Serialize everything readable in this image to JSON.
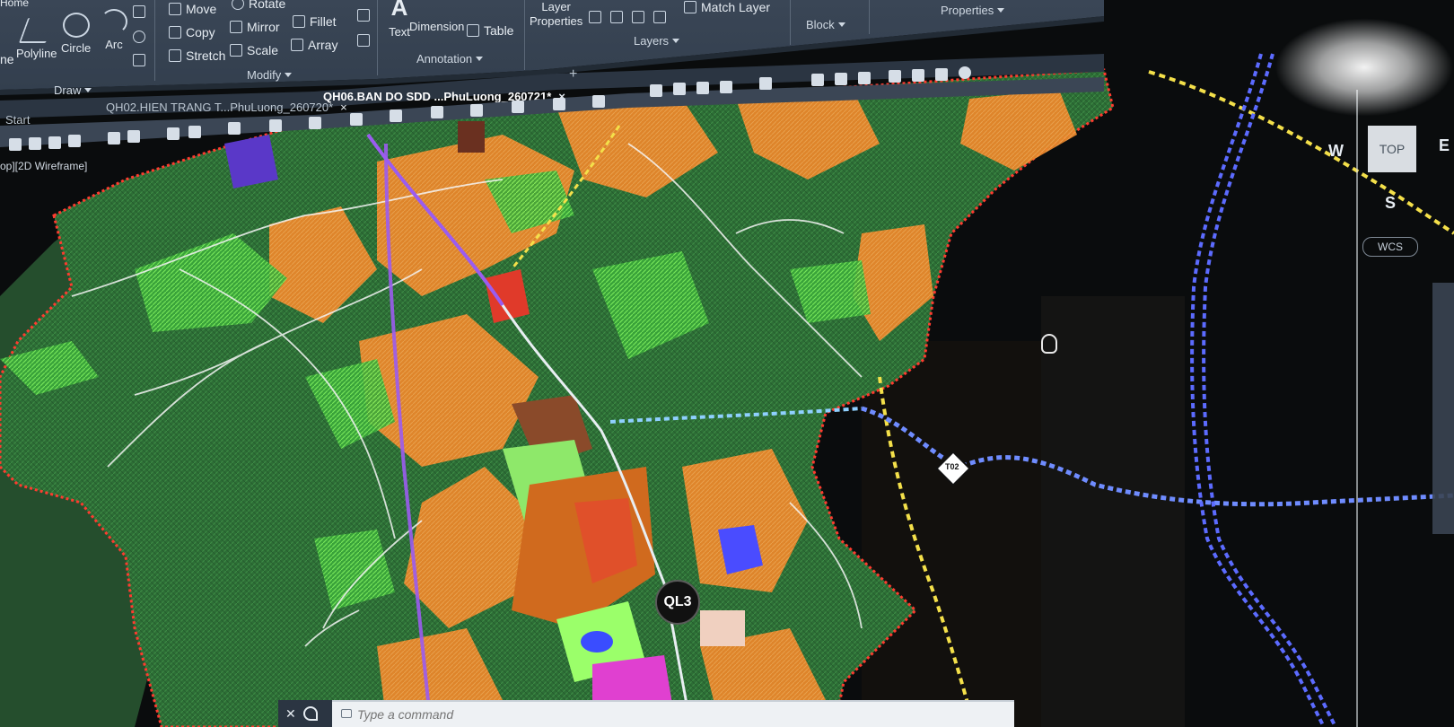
{
  "ribbon": {
    "draw": {
      "tools": [
        "Polyline",
        "Circle",
        "Arc"
      ],
      "group_label": "Draw",
      "home_tab": "Home",
      "line_label": "ne"
    },
    "modify": {
      "tools": [
        "Move",
        "Rotate",
        "Copy",
        "Mirror",
        "Fillet",
        "Stretch",
        "Scale",
        "Array"
      ],
      "group_label": "Modify"
    },
    "annotation": {
      "tools": [
        "Text",
        "Dimension",
        "Table"
      ],
      "group_label": "Annotation"
    },
    "layers": {
      "layer_properties_line1": "Layer",
      "layer_properties_line2": "Properties",
      "match_layer": "Match Layer",
      "group_label": "Layers"
    },
    "block": {
      "group_label": "Block"
    },
    "properties": {
      "group_label": "Properties"
    }
  },
  "file_tabs": {
    "start": "Start",
    "tabs": [
      {
        "label": "QH02.HIEN TRANG T...PhuLuong_260720*",
        "active": false
      },
      {
        "label": "QH06.BAN DO SDD ...PhuLuong_260721*",
        "active": true
      }
    ],
    "close_glyph": "×",
    "new_tab_glyph": "+"
  },
  "viewport": {
    "label": "op][2D Wireframe]"
  },
  "viewcube": {
    "top": "TOP",
    "west": "W",
    "east": "E",
    "south": "S",
    "wcs": "WCS"
  },
  "map": {
    "highway_label": "QL3",
    "route_marker": "T02",
    "colors": {
      "forest": "#2f7a3a",
      "forest_dark": "#1f5a2a",
      "agri": "#e8862a",
      "green_bright": "#5fe04a",
      "boundary": "#ff3b2f",
      "yellow_route": "#f4e04a",
      "blue_route": "#5c6bff",
      "cyan_route": "#6fb6ff",
      "purple_route": "#9b5cf0"
    }
  },
  "command_line": {
    "placeholder": "Type a command",
    "close_glyph": "✕"
  }
}
